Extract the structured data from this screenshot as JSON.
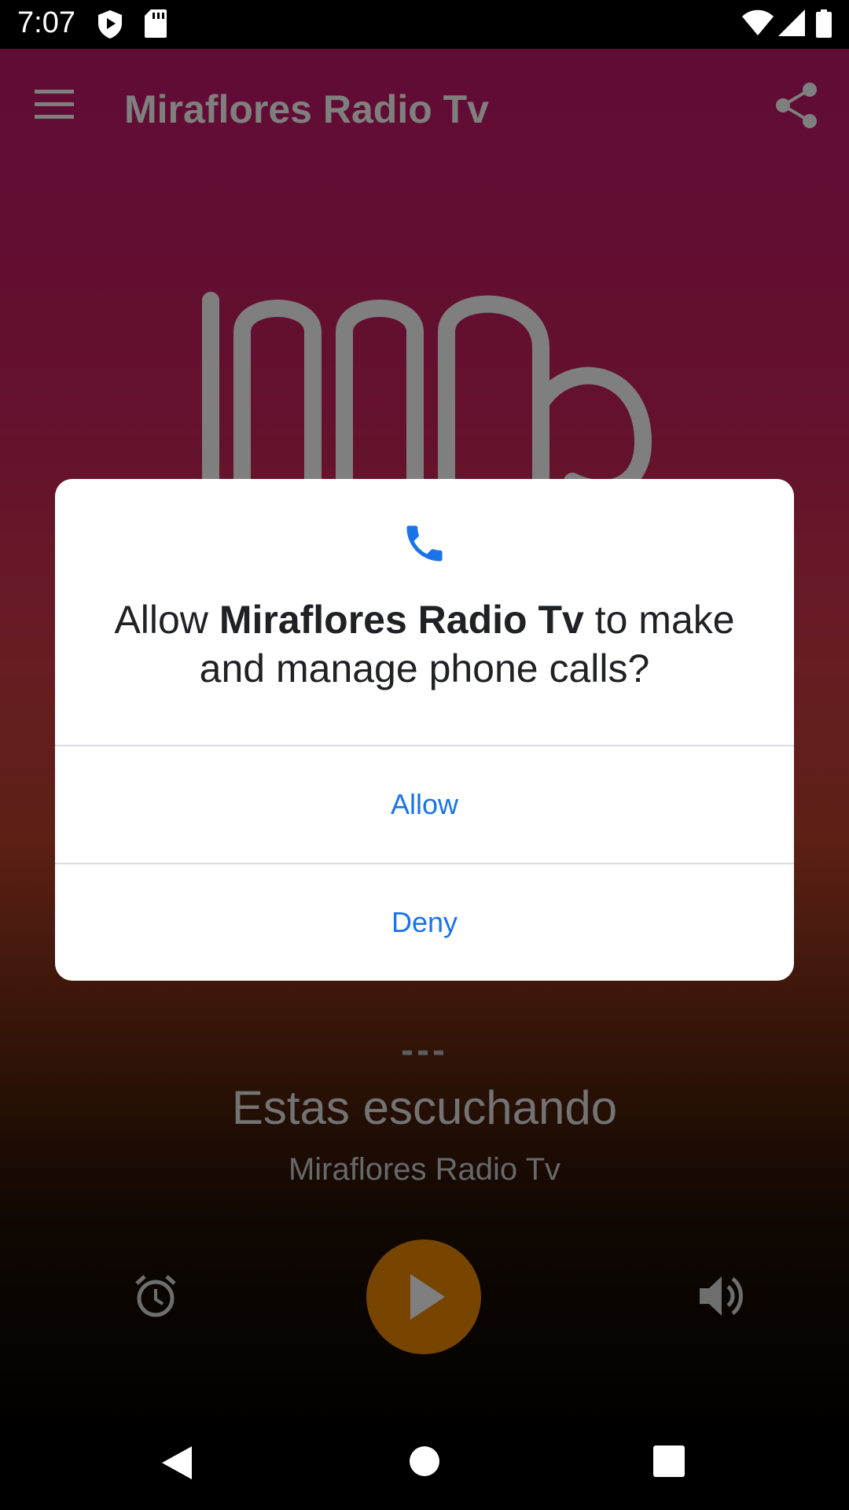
{
  "status_bar": {
    "time": "7:07",
    "icons": [
      "play-protect-icon",
      "sd-card-icon",
      "wifi-icon",
      "signal-icon",
      "battery-icon"
    ]
  },
  "app_bar": {
    "title": "Miraflores Radio Tv",
    "menu_icon": "menu-icon",
    "share_icon": "share-icon"
  },
  "now_playing": {
    "dashes": "---",
    "label": "Estas escuchando",
    "station": "Miraflores Radio Tv"
  },
  "controls": {
    "alarm_icon": "alarm-icon",
    "play_icon": "play-icon",
    "volume_icon": "volume-icon"
  },
  "dialog": {
    "icon": "phone-icon",
    "message_prefix": "Allow ",
    "app_name": "Miraflores Radio Tv",
    "message_suffix": " to make and manage phone calls?",
    "allow_label": "Allow",
    "deny_label": "Deny"
  },
  "nav_bar": {
    "icons": [
      "back-icon",
      "home-icon",
      "recents-icon"
    ]
  },
  "colors": {
    "accent": "#1a73e8",
    "play_button": "#ee8a00",
    "background_top": "#c2186b"
  }
}
